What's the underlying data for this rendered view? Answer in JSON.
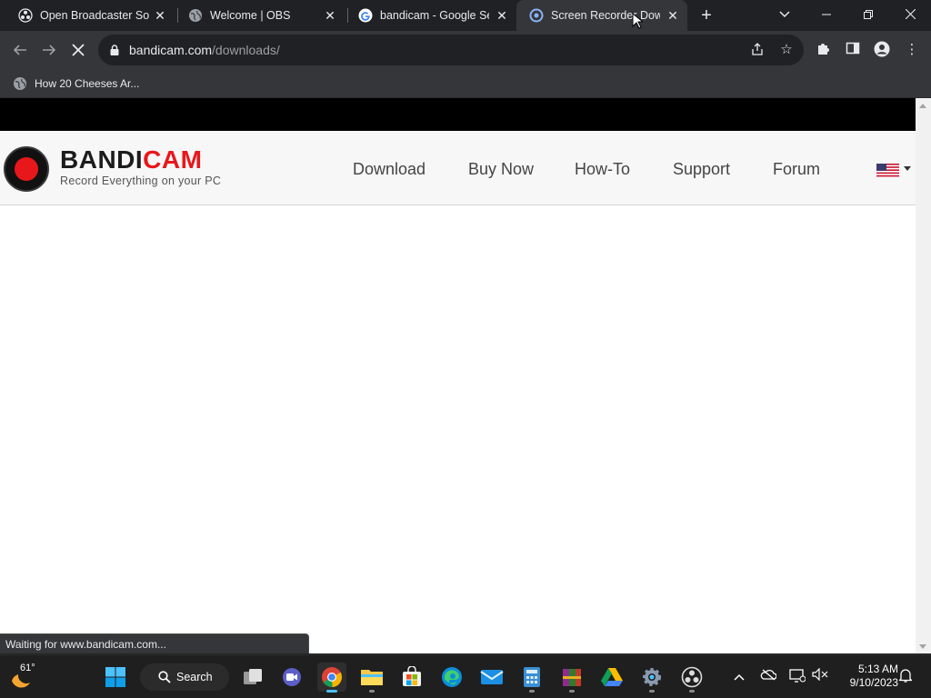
{
  "browser": {
    "tabs": [
      {
        "title": "Open Broadcaster Software",
        "icon": "obs-icon",
        "active": false
      },
      {
        "title": "Welcome | OBS",
        "icon": "globe-icon",
        "active": false
      },
      {
        "title": "bandicam - Google Search",
        "icon": "google-icon",
        "active": false
      },
      {
        "title": "Screen Recorder Download",
        "icon": "bandicam-icon",
        "active": true
      }
    ],
    "new_tab": "+",
    "url_host": "bandicam.com",
    "url_path": "/downloads/",
    "bookmark": "How 20 Cheeses Ar...",
    "status_text": "Waiting for www.bandicam.com..."
  },
  "site": {
    "brand_part1": "BANDI",
    "brand_part2": "CAM",
    "tagline": "Record Everything on your PC",
    "nav": [
      "Download",
      "Buy Now",
      "How-To",
      "Support",
      "Forum"
    ],
    "accent": "#e8171b"
  },
  "taskbar": {
    "weather_temp": "61°",
    "search_label": "Search",
    "time": "5:13 AM",
    "date": "9/10/2023"
  }
}
